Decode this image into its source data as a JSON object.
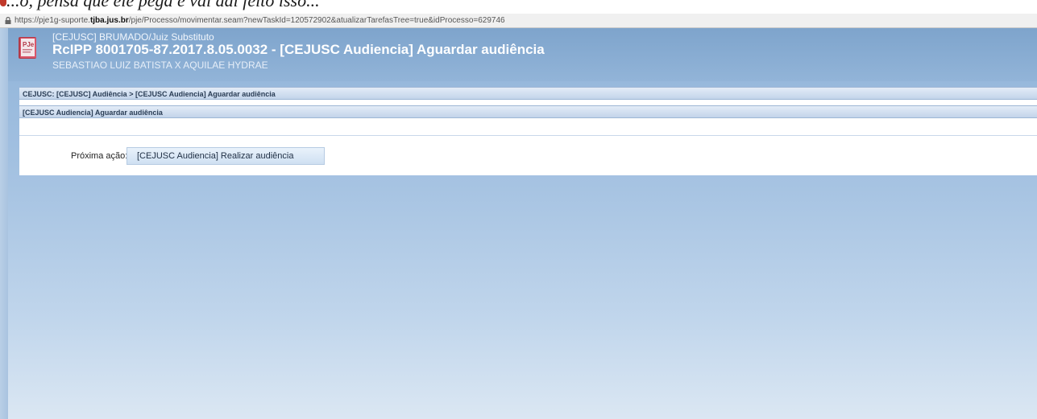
{
  "browser": {
    "url_prefix": "https://pje1g-suporte.",
    "url_domain": "tjba.jus.br",
    "url_rest": "/pje/Processo/movimentar.seam?newTaskId=120572902&atualizarTarefasTree=true&idProcesso=629746",
    "cut_text": "...o, pensa que ele pega e vai daí feito isso..."
  },
  "header": {
    "subtitle": "[CEJUSC] BRUMADO/Juiz Substituto",
    "title": "RcIPP 8001705-87.2017.8.05.0032 - [CEJUSC Audiencia] Aguardar audiência",
    "parties": "SEBASTIAO LUIZ BATISTA X AQUILAE HYDRAE",
    "logo_icon": "pje-logo-icon"
  },
  "panel": {
    "breadcrumb": "CEJUSC: [CEJUSC] Audiência > [CEJUSC Audiencia] Aguardar audiência",
    "task_title": "[CEJUSC Audiencia] Aguardar audiência",
    "next_action_label": "Próxima ação:",
    "next_action_button": "[CEJUSC Audiencia] Realizar audiência"
  },
  "colors": {
    "header_blue": "#7ea4cc",
    "background_blue": "#a6c3e2",
    "bar_blue": "#c3d4ea"
  }
}
